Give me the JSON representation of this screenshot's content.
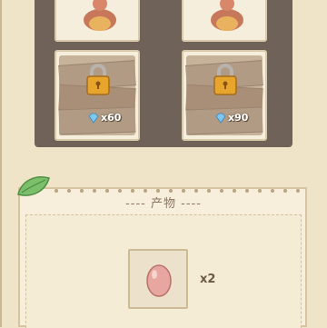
{
  "shop": {
    "slots": [
      {
        "state": "unlocked",
        "icon": "hen-icon"
      },
      {
        "state": "unlocked",
        "icon": "hen-icon"
      },
      {
        "state": "locked",
        "icon": "padlock-icon",
        "price": "x60",
        "currency_icon": "diamond-icon"
      },
      {
        "state": "locked",
        "icon": "padlock-icon",
        "price": "x90",
        "currency_icon": "diamond-icon"
      }
    ]
  },
  "products": {
    "title": "---- 产物 ----",
    "items": [
      {
        "icon": "egg-icon",
        "count": "x2"
      }
    ]
  },
  "colors": {
    "panel": "#efe3c8",
    "grid": "#6f6259",
    "gold": "#e8a52c",
    "egg": "#e7a7a0"
  }
}
